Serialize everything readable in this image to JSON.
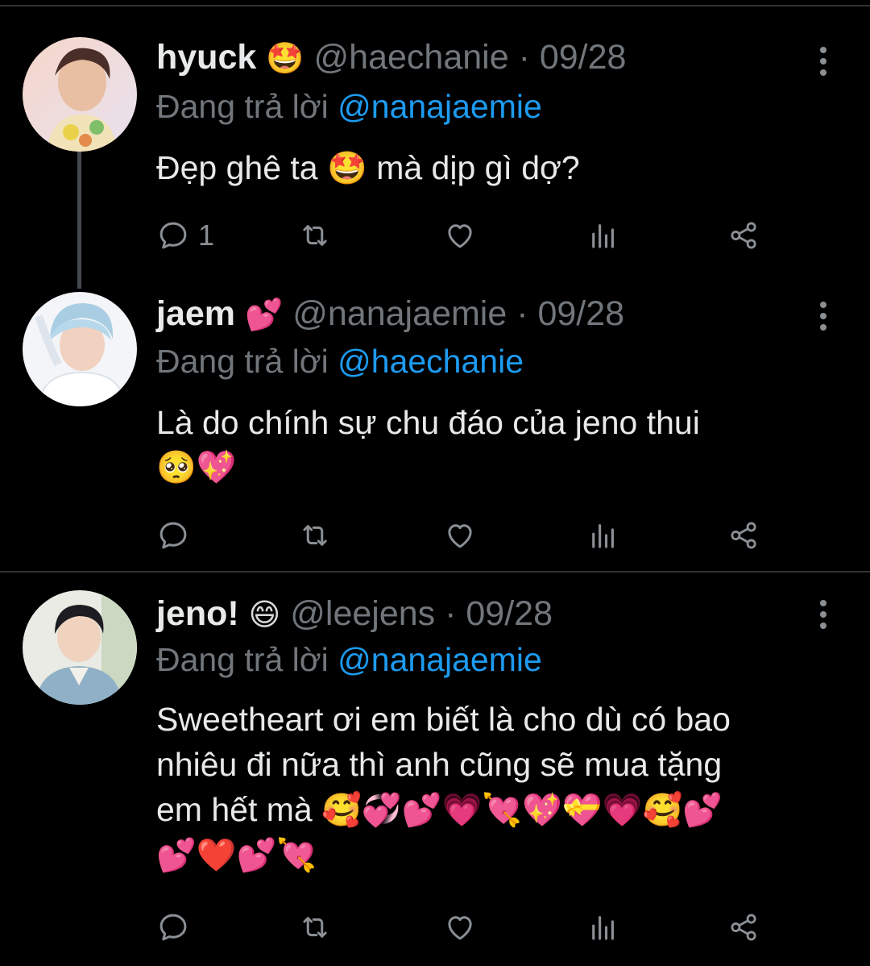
{
  "colors": {
    "background": "#000000",
    "text": "#e7e9ea",
    "muted": "#71767b",
    "link": "#1d9bf0",
    "divider": "#2f3336"
  },
  "tweets": [
    {
      "name": "hyuck",
      "name_emoji": "🤩",
      "handle": "@haechanie",
      "date": "· 09/28",
      "reply_prefix": "Đang trả lời",
      "reply_to": "@nanajaemie",
      "text_parts": [
        "Đẹp ghê ta ",
        "🤩",
        " mà dịp gì dợ?"
      ],
      "reply_count": "1",
      "avatar_icon": "profile-photo-hyuck"
    },
    {
      "name": "jaem",
      "name_emoji": "💕",
      "handle": "@nanajaemie",
      "date": "· 09/28",
      "reply_prefix": "Đang trả lời",
      "reply_to": "@haechanie",
      "text": "Là do chính sự chu đáo của jeno thui",
      "text_emoji": "🥺💖",
      "reply_count": "",
      "avatar_icon": "profile-photo-jaem"
    },
    {
      "name": "jeno!",
      "name_emoji": "😄",
      "handle": "@leejens",
      "date": "· 09/28",
      "reply_prefix": "Đang trả lời",
      "reply_to": "@nanajaemie",
      "text_line1": "Sweetheart ơi em biết là cho dù có bao",
      "text_line2": "nhiêu đi nữa thì anh cũng sẽ mua tặng",
      "text_line3": "em hết mà ",
      "text_emoji_line3": "🥰💞💕💗💘💖💝💗🥰💕",
      "text_emoji_line4": "💕❤️💕💘",
      "reply_count": "",
      "avatar_icon": "profile-photo-jeno"
    }
  ],
  "action_icons": [
    "reply-icon",
    "retweet-icon",
    "like-icon",
    "views-icon",
    "share-icon"
  ]
}
